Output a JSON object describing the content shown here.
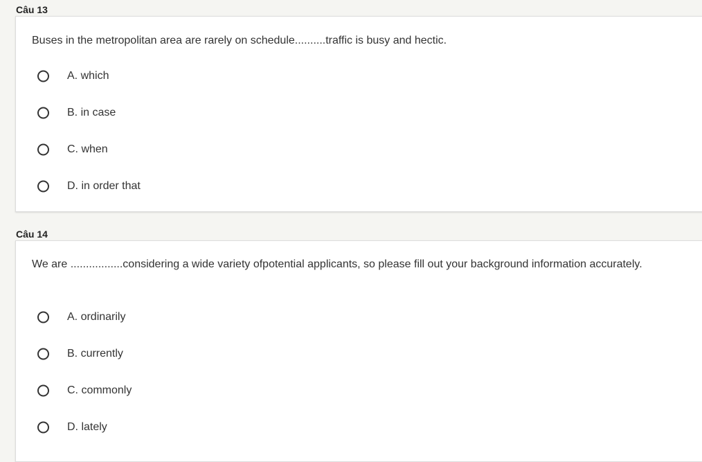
{
  "questions": [
    {
      "title": "Câu 13",
      "text": "Buses in the metropolitan area are rarely on schedule..........traffic is busy and hectic.",
      "options": [
        {
          "label": "A. which"
        },
        {
          "label": "B. in case"
        },
        {
          "label": "C. when"
        },
        {
          "label": "D. in order that"
        }
      ]
    },
    {
      "title": "Câu 14",
      "text": "We are .................considering a wide variety ofpotential applicants, so please fill out your background information accurately.",
      "options": [
        {
          "label": "A. ordinarily"
        },
        {
          "label": "B. currently"
        },
        {
          "label": "C. commonly"
        },
        {
          "label": "D. lately"
        }
      ]
    }
  ]
}
